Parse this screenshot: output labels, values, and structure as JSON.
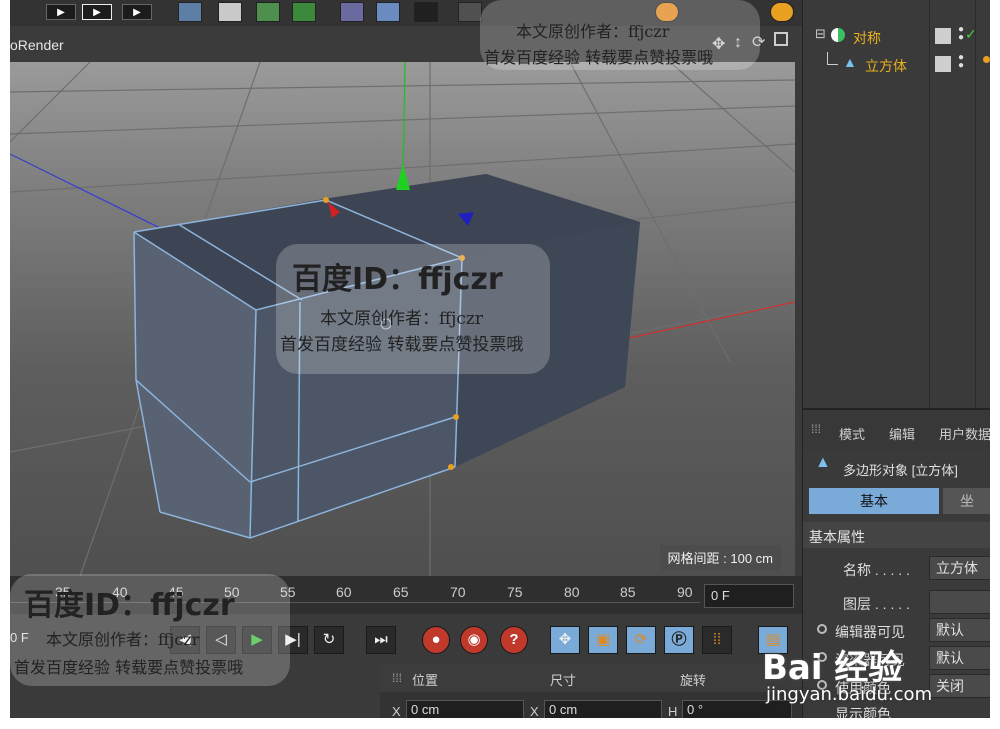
{
  "viewport": {
    "title": "oRender",
    "grid_distance": "网格间距 : 100 cm"
  },
  "timeline": {
    "ticks": [
      "35",
      "40",
      "45",
      "50",
      "55",
      "60",
      "65",
      "70",
      "75",
      "80",
      "85",
      "90"
    ],
    "current_frame": "0 F",
    "left_frame": "0 F"
  },
  "objects": [
    {
      "name": "对称",
      "color": "#e8b020"
    },
    {
      "name": "立方体",
      "color": "#e8b020"
    }
  ],
  "attributes": {
    "tabs": [
      "模式",
      "编辑",
      "用户数据"
    ],
    "object_title": "多边形对象 [立方体]",
    "subtabs": [
      "基本",
      "坐"
    ],
    "section": "基本属性",
    "fields": [
      {
        "label": "名称 . . . . .",
        "value": "立方体"
      },
      {
        "label": "图层 . . . . .",
        "value": ""
      },
      {
        "label": "编辑器可见",
        "value": "默认"
      },
      {
        "label": "渲染器可见",
        "value": "默认"
      },
      {
        "label": "使用颜色",
        "value": "关闭"
      },
      {
        "label": "显示颜色",
        "value": ""
      }
    ]
  },
  "coords": {
    "headers": [
      "位置",
      "尺寸",
      "旋转"
    ],
    "values": [
      {
        "axis": "X",
        "value": "0 cm"
      },
      {
        "axis": "X",
        "value": "0 cm"
      },
      {
        "axis": "H",
        "value": "0 °"
      }
    ]
  },
  "watermark": {
    "id_text": "百度ID：ffjczr",
    "author_line": "本文原创作者：ffjczr",
    "notice_line": "首发百度经验  转载要点赞投票哦",
    "brand": "Bai 经验",
    "brand_url": "jingyan.baidu.com"
  },
  "colors": {
    "selection": "#e8a020",
    "axis_x": "#d03030",
    "axis_y": "#20c020",
    "axis_z": "#3030d0",
    "active_blue": "#7aaad8"
  }
}
